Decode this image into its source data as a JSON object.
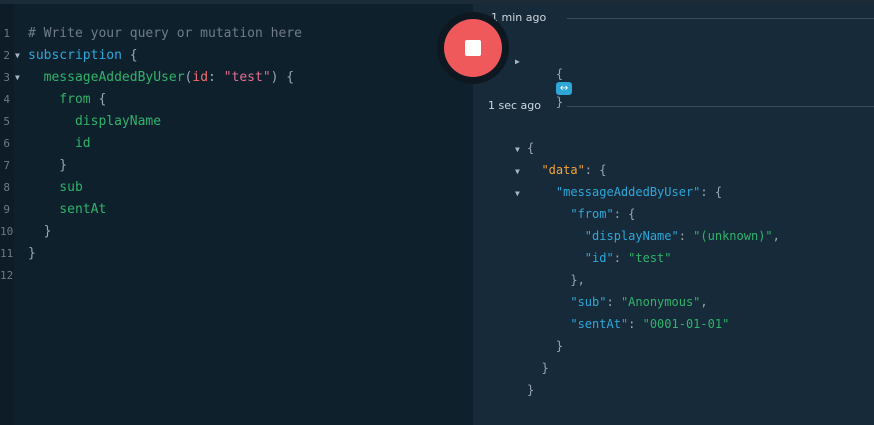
{
  "editor": {
    "lines": [
      {
        "num": "1",
        "parts": [
          {
            "t": "# Write your query or mutation here",
            "c": "c-comment"
          }
        ]
      },
      {
        "num": "2",
        "fold": true,
        "parts": [
          {
            "t": "subscription",
            "c": "c-kw"
          },
          {
            "t": " {",
            "c": "c-punc"
          }
        ]
      },
      {
        "num": "3",
        "fold": true,
        "parts": [
          {
            "t": "  messageAddedByUser",
            "c": "c-field"
          },
          {
            "t": "(",
            "c": "c-punc"
          },
          {
            "t": "id",
            "c": "c-arg"
          },
          {
            "t": ": ",
            "c": "c-punc"
          },
          {
            "t": "\"test\"",
            "c": "c-str"
          },
          {
            "t": ") {",
            "c": "c-punc"
          }
        ]
      },
      {
        "num": "4",
        "parts": [
          {
            "t": "    from",
            "c": "c-field"
          },
          {
            "t": " {",
            "c": "c-punc"
          }
        ]
      },
      {
        "num": "5",
        "parts": [
          {
            "t": "      displayName",
            "c": "c-field"
          }
        ]
      },
      {
        "num": "6",
        "parts": [
          {
            "t": "      id",
            "c": "c-field"
          }
        ]
      },
      {
        "num": "7",
        "parts": [
          {
            "t": "    }",
            "c": "c-punc"
          }
        ]
      },
      {
        "num": "8",
        "parts": [
          {
            "t": "    sub",
            "c": "c-field"
          }
        ]
      },
      {
        "num": "9",
        "parts": [
          {
            "t": "    sentAt",
            "c": "c-field"
          }
        ]
      },
      {
        "num": "10",
        "parts": [
          {
            "t": "  }",
            "c": "c-punc"
          }
        ]
      },
      {
        "num": "11",
        "parts": [
          {
            "t": "}",
            "c": "c-punc"
          }
        ]
      },
      {
        "num": "12",
        "parts": []
      }
    ]
  },
  "stop_button": {
    "icon": "stop-icon"
  },
  "results": {
    "first": {
      "timestamp": "1 min ago",
      "collapsed_open": "{",
      "badge": "↔",
      "collapsed_close": "}"
    },
    "second": {
      "timestamp": "1 sec ago",
      "lines": [
        {
          "tri": true,
          "parts": [
            {
              "t": "{",
              "c": "jpunc"
            }
          ]
        },
        {
          "tri": true,
          "parts": [
            {
              "t": "  \"data\"",
              "c": "jkey-data"
            },
            {
              "t": ": {",
              "c": "jpunc"
            }
          ]
        },
        {
          "tri": true,
          "parts": [
            {
              "t": "    \"messageAddedByUser\"",
              "c": "jkey"
            },
            {
              "t": ": {",
              "c": "jpunc"
            }
          ]
        },
        {
          "parts": [
            {
              "t": "      \"from\"",
              "c": "jkey"
            },
            {
              "t": ": {",
              "c": "jpunc"
            }
          ]
        },
        {
          "parts": [
            {
              "t": "        \"displayName\"",
              "c": "jkey"
            },
            {
              "t": ": ",
              "c": "jpunc"
            },
            {
              "t": "\"(unknown)\"",
              "c": "jstr"
            },
            {
              "t": ",",
              "c": "jpunc"
            }
          ]
        },
        {
          "parts": [
            {
              "t": "        \"id\"",
              "c": "jkey"
            },
            {
              "t": ": ",
              "c": "jpunc"
            },
            {
              "t": "\"test\"",
              "c": "jstr"
            }
          ]
        },
        {
          "parts": [
            {
              "t": "      },",
              "c": "jpunc"
            }
          ]
        },
        {
          "parts": [
            {
              "t": "      \"sub\"",
              "c": "jkey"
            },
            {
              "t": ": ",
              "c": "jpunc"
            },
            {
              "t": "\"Anonymous\"",
              "c": "jstr"
            },
            {
              "t": ",",
              "c": "jpunc"
            }
          ]
        },
        {
          "parts": [
            {
              "t": "      \"sentAt\"",
              "c": "jkey"
            },
            {
              "t": ": ",
              "c": "jpunc"
            },
            {
              "t": "\"0001-01-01\"",
              "c": "jstr"
            }
          ]
        },
        {
          "parts": [
            {
              "t": "    }",
              "c": "jpunc"
            }
          ]
        },
        {
          "parts": [
            {
              "t": "  }",
              "c": "jpunc"
            }
          ]
        },
        {
          "parts": [
            {
              "t": "}",
              "c": "jpunc"
            }
          ]
        }
      ]
    }
  }
}
